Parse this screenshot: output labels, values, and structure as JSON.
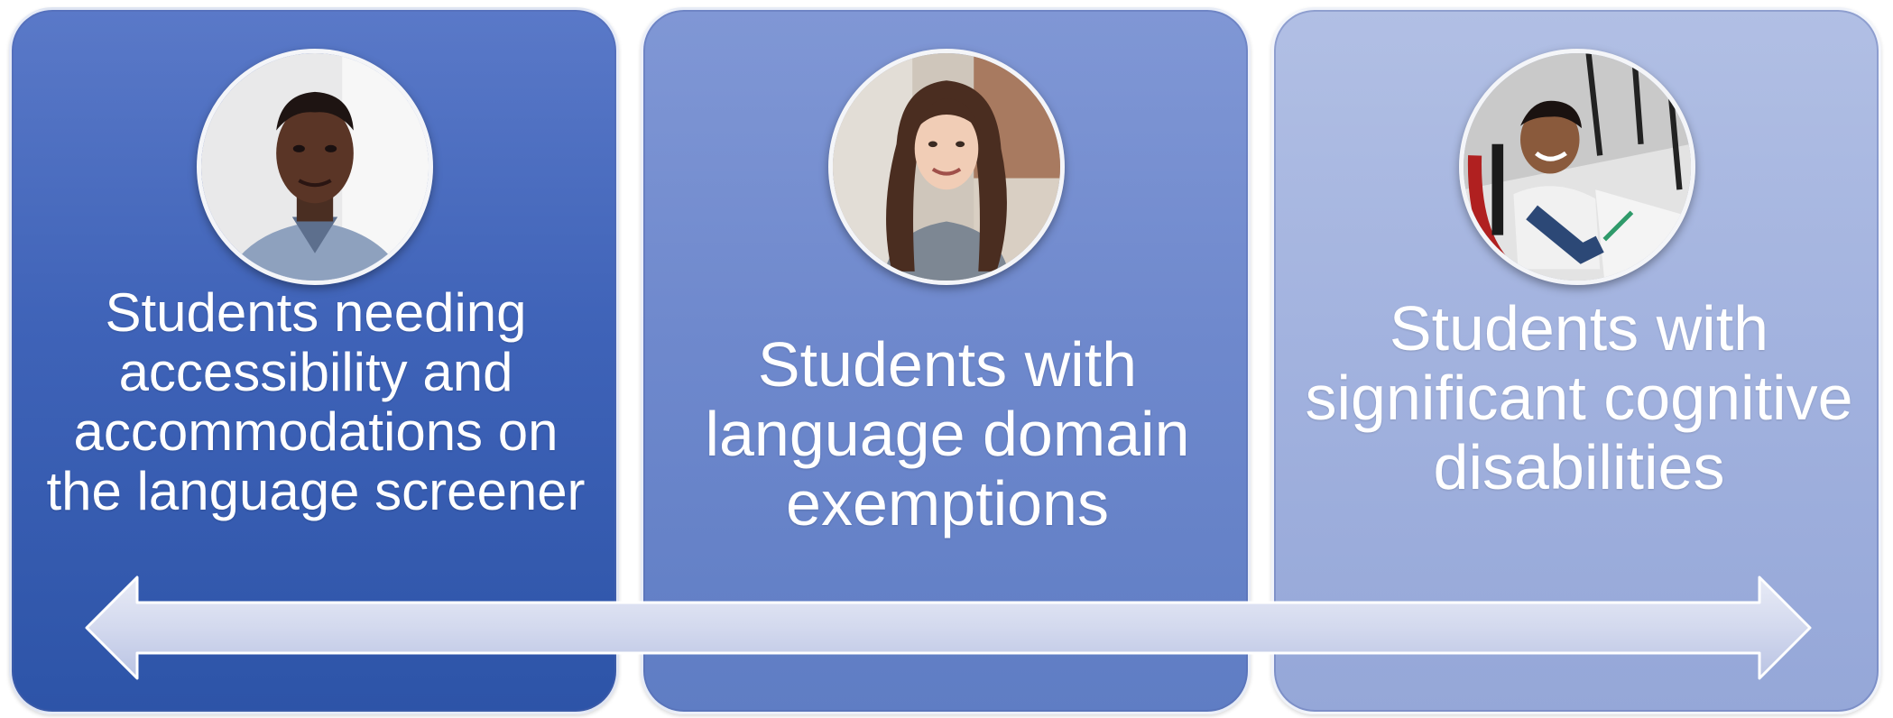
{
  "panels": [
    {
      "label": "Students needing accessibility and accommodations on the language screener",
      "photo_icon": "student-portrait-icon",
      "color": "#3f63b8"
    },
    {
      "label": "Students with language domain exemptions",
      "photo_icon": "student-portrait-icon",
      "color": "#6f89cd"
    },
    {
      "label": "Students with significant cognitive disabilities",
      "photo_icon": "student-wheelchair-icon",
      "color": "#a3b3df"
    }
  ],
  "arrow": {
    "type": "double-headed",
    "color": "#d3d9ee"
  }
}
